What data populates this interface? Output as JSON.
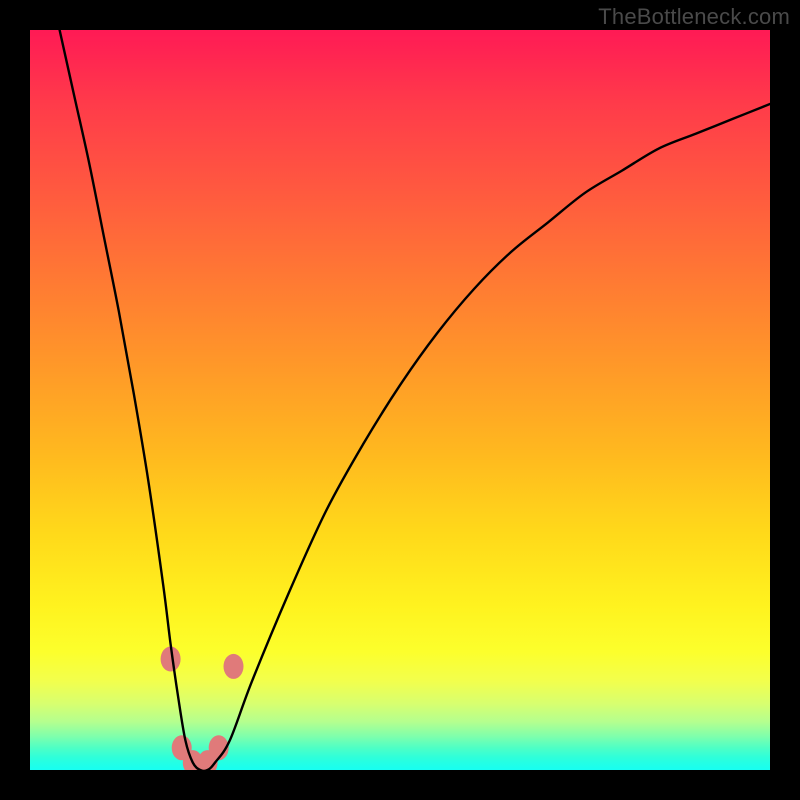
{
  "attribution": "TheBottleneck.com",
  "chart_data": {
    "type": "line",
    "title": "",
    "xlabel": "",
    "ylabel": "",
    "xlim": [
      0,
      100
    ],
    "ylim": [
      0,
      100
    ],
    "background_gradient": {
      "orientation": "vertical",
      "stops": [
        {
          "pos": 0.0,
          "color": "#ff1a55"
        },
        {
          "pos": 0.1,
          "color": "#ff3b4a"
        },
        {
          "pos": 0.22,
          "color": "#ff5a3f"
        },
        {
          "pos": 0.34,
          "color": "#ff7a33"
        },
        {
          "pos": 0.46,
          "color": "#ff9a28"
        },
        {
          "pos": 0.57,
          "color": "#ffb81f"
        },
        {
          "pos": 0.68,
          "color": "#ffd91a"
        },
        {
          "pos": 0.78,
          "color": "#fff31f"
        },
        {
          "pos": 0.84,
          "color": "#fcff2c"
        },
        {
          "pos": 0.88,
          "color": "#f2ff4d"
        },
        {
          "pos": 0.91,
          "color": "#d8ff6f"
        },
        {
          "pos": 0.935,
          "color": "#b4ff8f"
        },
        {
          "pos": 0.955,
          "color": "#7dffad"
        },
        {
          "pos": 0.97,
          "color": "#4effc5"
        },
        {
          "pos": 0.982,
          "color": "#30ffd9"
        },
        {
          "pos": 0.993,
          "color": "#20ffe8"
        },
        {
          "pos": 1.0,
          "color": "#17fff2"
        }
      ]
    },
    "series": [
      {
        "name": "bottleneck-curve",
        "color": "#000000",
        "x": [
          4,
          6,
          8,
          10,
          12,
          14,
          16,
          18,
          19,
          20,
          21,
          22,
          23,
          24,
          25,
          27,
          30,
          35,
          40,
          45,
          50,
          55,
          60,
          65,
          70,
          75,
          80,
          85,
          90,
          95,
          100
        ],
        "y": [
          100,
          91,
          82,
          72,
          62,
          51,
          39,
          25,
          17,
          10,
          4,
          1,
          0,
          0,
          1,
          4,
          12,
          24,
          35,
          44,
          52,
          59,
          65,
          70,
          74,
          78,
          81,
          84,
          86,
          88,
          90
        ]
      }
    ],
    "markers": [
      {
        "x": 19.0,
        "y": 15,
        "color": "#e07a7a",
        "r": 10
      },
      {
        "x": 20.5,
        "y": 3,
        "color": "#e07a7a",
        "r": 10
      },
      {
        "x": 22.0,
        "y": 1,
        "color": "#e07a7a",
        "r": 10
      },
      {
        "x": 24.0,
        "y": 1,
        "color": "#e07a7a",
        "r": 10
      },
      {
        "x": 25.5,
        "y": 3,
        "color": "#e07a7a",
        "r": 10
      },
      {
        "x": 27.5,
        "y": 14,
        "color": "#e07a7a",
        "r": 10
      }
    ]
  }
}
